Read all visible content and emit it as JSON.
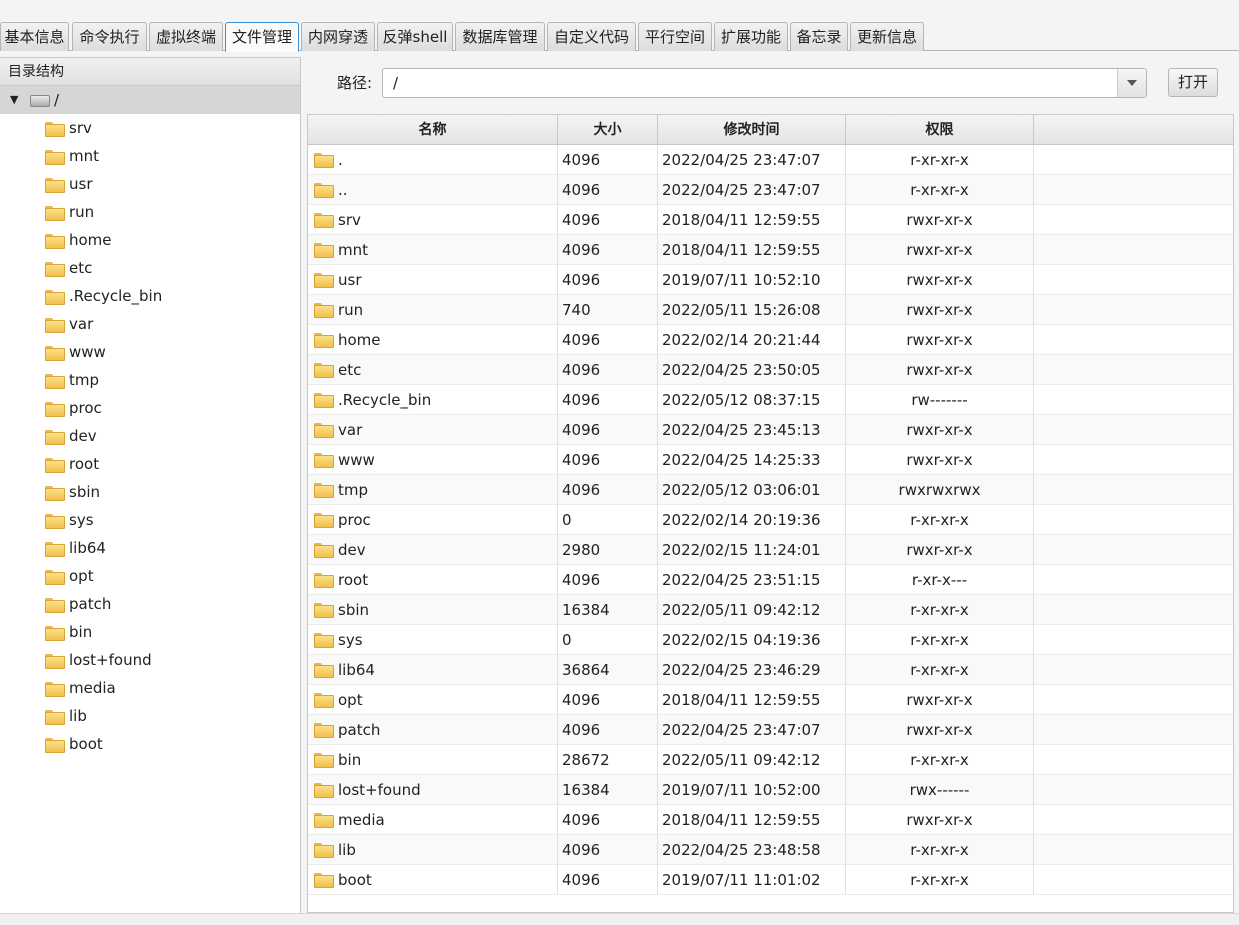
{
  "tabs": [
    "基本信息",
    "命令执行",
    "虚拟终端",
    "文件管理",
    "内网穿透",
    "反弹shell",
    "数据库管理",
    "自定义代码",
    "平行空间",
    "扩展功能",
    "备忘录",
    "更新信息"
  ],
  "active_tab": "文件管理",
  "sidebar": {
    "title": "目录结构",
    "root": "/",
    "items": [
      "srv",
      "mnt",
      "usr",
      "run",
      "home",
      "etc",
      ".Recycle_bin",
      "var",
      "www",
      "tmp",
      "proc",
      "dev",
      "root",
      "sbin",
      "sys",
      "lib64",
      "opt",
      "patch",
      "bin",
      "lost+found",
      "media",
      "lib",
      "boot"
    ]
  },
  "path_bar": {
    "label": "路径:",
    "value": "/",
    "open_label": "打开"
  },
  "table": {
    "headers": [
      "名称",
      "大小",
      "修改时间",
      "权限"
    ],
    "rows": [
      [
        ".",
        "4096",
        "2022/04/25 23:47:07",
        "r-xr-xr-x"
      ],
      [
        "..",
        "4096",
        "2022/04/25 23:47:07",
        "r-xr-xr-x"
      ],
      [
        "srv",
        "4096",
        "2018/04/11 12:59:55",
        "rwxr-xr-x"
      ],
      [
        "mnt",
        "4096",
        "2018/04/11 12:59:55",
        "rwxr-xr-x"
      ],
      [
        "usr",
        "4096",
        "2019/07/11 10:52:10",
        "rwxr-xr-x"
      ],
      [
        "run",
        "740",
        "2022/05/11 15:26:08",
        "rwxr-xr-x"
      ],
      [
        "home",
        "4096",
        "2022/02/14 20:21:44",
        "rwxr-xr-x"
      ],
      [
        "etc",
        "4096",
        "2022/04/25 23:50:05",
        "rwxr-xr-x"
      ],
      [
        ".Recycle_bin",
        "4096",
        "2022/05/12 08:37:15",
        "rw-------"
      ],
      [
        "var",
        "4096",
        "2022/04/25 23:45:13",
        "rwxr-xr-x"
      ],
      [
        "www",
        "4096",
        "2022/04/25 14:25:33",
        "rwxr-xr-x"
      ],
      [
        "tmp",
        "4096",
        "2022/05/12 03:06:01",
        "rwxrwxrwx"
      ],
      [
        "proc",
        "0",
        "2022/02/14 20:19:36",
        "r-xr-xr-x"
      ],
      [
        "dev",
        "2980",
        "2022/02/15 11:24:01",
        "rwxr-xr-x"
      ],
      [
        "root",
        "4096",
        "2022/04/25 23:51:15",
        "r-xr-x---"
      ],
      [
        "sbin",
        "16384",
        "2022/05/11 09:42:12",
        "r-xr-xr-x"
      ],
      [
        "sys",
        "0",
        "2022/02/15 04:19:36",
        "r-xr-xr-x"
      ],
      [
        "lib64",
        "36864",
        "2022/04/25 23:46:29",
        "r-xr-xr-x"
      ],
      [
        "opt",
        "4096",
        "2018/04/11 12:59:55",
        "rwxr-xr-x"
      ],
      [
        "patch",
        "4096",
        "2022/04/25 23:47:07",
        "rwxr-xr-x"
      ],
      [
        "bin",
        "28672",
        "2022/05/11 09:42:12",
        "r-xr-xr-x"
      ],
      [
        "lost+found",
        "16384",
        "2019/07/11 10:52:00",
        "rwx------"
      ],
      [
        "media",
        "4096",
        "2018/04/11 12:59:55",
        "rwxr-xr-x"
      ],
      [
        "lib",
        "4096",
        "2022/04/25 23:48:58",
        "r-xr-xr-x"
      ],
      [
        "boot",
        "4096",
        "2019/07/11 11:01:02",
        "r-xr-xr-x"
      ]
    ]
  }
}
